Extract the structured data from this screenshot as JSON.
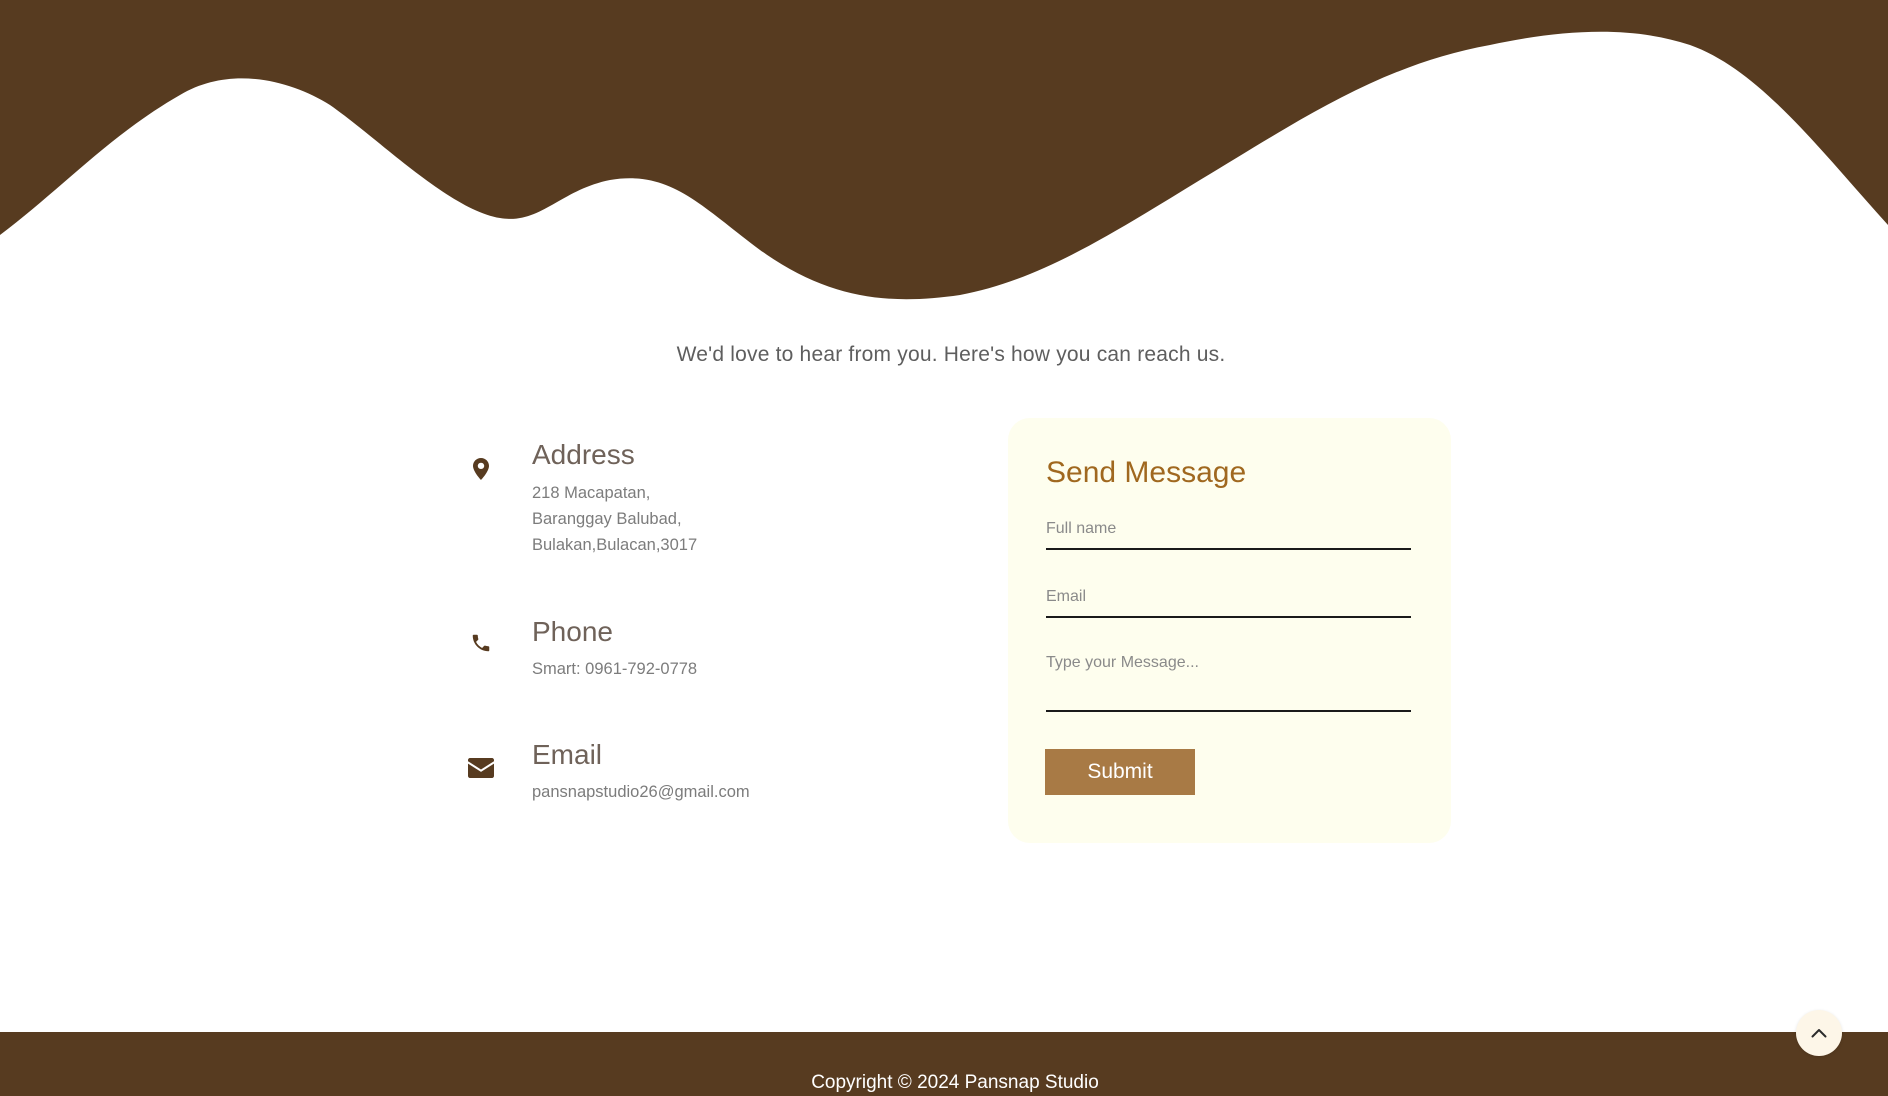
{
  "colors": {
    "brand_brown": "#573b20",
    "accent_gold": "#a0681f",
    "button_tan": "#a87a45",
    "card_cream": "#fefeee"
  },
  "intro_text": "We'd love to hear from you. Here's how you can reach us.",
  "contact": {
    "address": {
      "icon": "map-pin-icon",
      "title": "Address",
      "lines": [
        "218 Macapatan,",
        "Baranggay Balubad,",
        "Bulakan,Bulacan,3017"
      ]
    },
    "phone": {
      "icon": "phone-icon",
      "title": "Phone",
      "lines": [
        "Smart: 0961-792-0778"
      ]
    },
    "email": {
      "icon": "envelope-icon",
      "title": "Email",
      "lines": [
        "pansnapstudio26@gmail.com"
      ]
    }
  },
  "form": {
    "title": "Send Message",
    "full_name_placeholder": "Full name",
    "full_name_value": "",
    "email_placeholder": "Email",
    "email_value": "",
    "message_placeholder": "Type your Message...",
    "message_value": "",
    "submit_label": "Submit"
  },
  "footer": {
    "copyright": "Copyright © 2024 Pansnap Studio"
  },
  "scroll_top": {
    "icon": "chevron-up-icon"
  }
}
